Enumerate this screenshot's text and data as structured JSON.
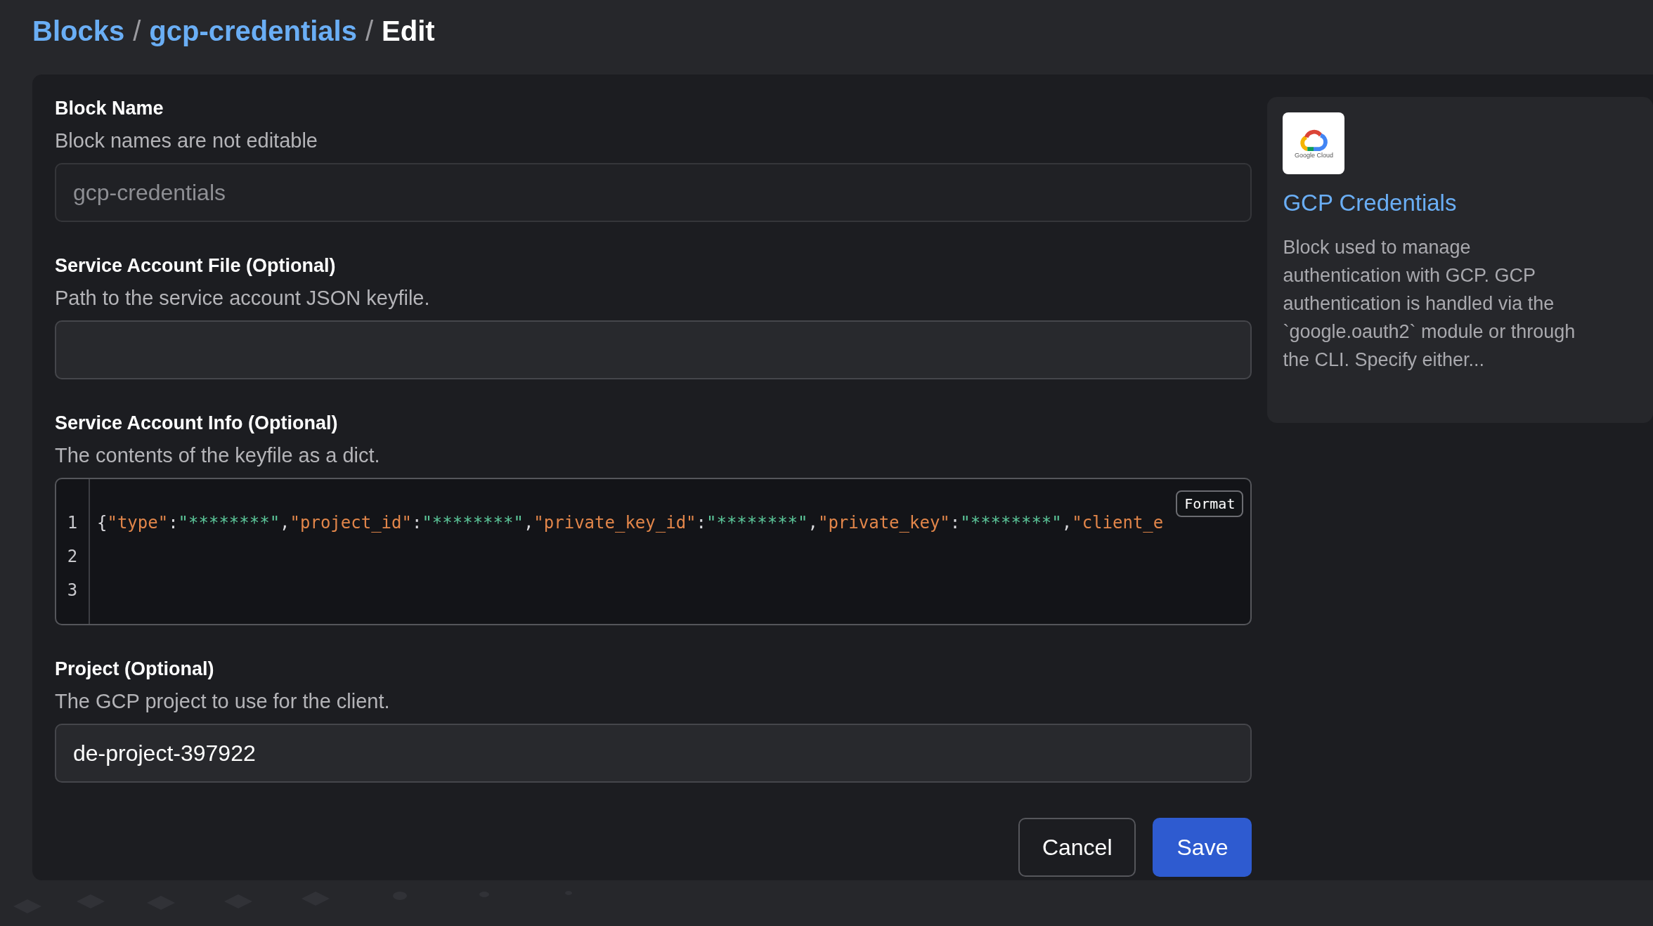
{
  "breadcrumb": [
    {
      "label": "Blocks",
      "kind": "link"
    },
    {
      "label": "/",
      "kind": "separator"
    },
    {
      "label": "gcp-credentials",
      "kind": "link"
    },
    {
      "label": "/",
      "kind": "separator"
    },
    {
      "label": "Edit",
      "kind": "current"
    }
  ],
  "fields": [
    {
      "kind": "text",
      "label": "Block Name",
      "help": "Block names are not editable",
      "value": "gcp-credentials",
      "disabled": true
    },
    {
      "kind": "text",
      "label": "Service Account File (Optional)",
      "help": "Path to the service account JSON keyfile.",
      "disabled": false
    },
    {
      "kind": "json",
      "label": "Service Account Info (Optional)",
      "help": "The contents of the keyfile as a dict.",
      "line_numbers": [
        "1",
        "2",
        "3"
      ],
      "format_button": "Format",
      "tokens": [
        {
          "kind": "punct",
          "text": "{"
        },
        {
          "kind": "key",
          "text": "\"type\""
        },
        {
          "kind": "punct",
          "text": ":"
        },
        {
          "kind": "string",
          "text": "\"********\""
        },
        {
          "kind": "punct",
          "text": ","
        },
        {
          "kind": "key",
          "text": "\"project_id\""
        },
        {
          "kind": "punct",
          "text": ":"
        },
        {
          "kind": "string",
          "text": "\"********\""
        },
        {
          "kind": "punct",
          "text": ","
        },
        {
          "kind": "key",
          "text": "\"private_key_id\""
        },
        {
          "kind": "punct",
          "text": ":"
        },
        {
          "kind": "string",
          "text": "\"********\""
        },
        {
          "kind": "punct",
          "text": ","
        },
        {
          "kind": "key",
          "text": "\"private_key\""
        },
        {
          "kind": "punct",
          "text": ":"
        },
        {
          "kind": "string",
          "text": "\"********\""
        },
        {
          "kind": "punct",
          "text": ","
        },
        {
          "kind": "key",
          "text": "\"client_e"
        }
      ]
    },
    {
      "kind": "text",
      "label": "Project (Optional)",
      "help": "The GCP project to use for the client.",
      "value": "de-project-397922",
      "disabled": false
    }
  ],
  "buttons": [
    {
      "label": "Cancel",
      "kind": "secondary"
    },
    {
      "label": "Save",
      "kind": "primary"
    }
  ],
  "block_card": {
    "logo_caption": "Google Cloud",
    "title": "GCP Credentials",
    "description": "Block used to manage authentication with GCP. GCP authentication is handled via the `google.oauth2` module or through the CLI. Specify either..."
  }
}
